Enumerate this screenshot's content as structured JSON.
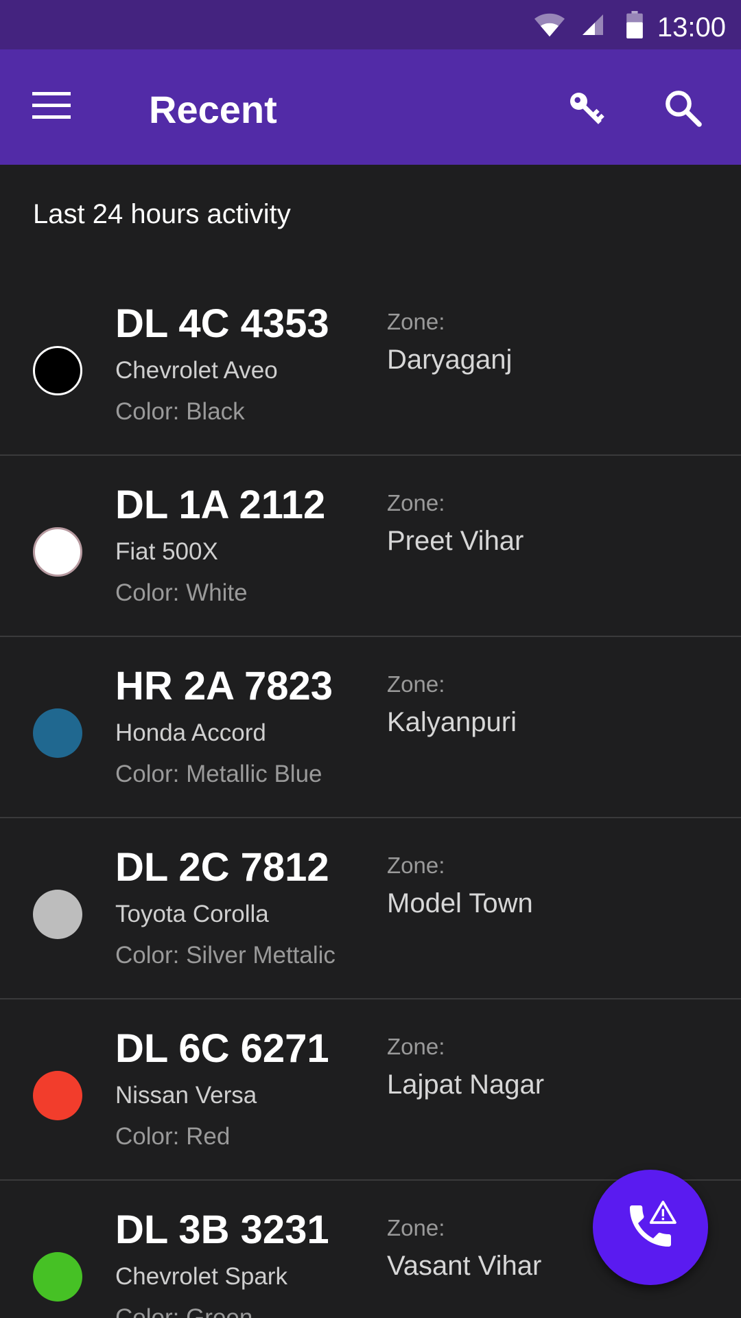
{
  "status_bar": {
    "time": "13:00",
    "icons": [
      "wifi-icon",
      "signal-icon",
      "battery-icon"
    ]
  },
  "app_bar": {
    "title": "Recent",
    "icons": [
      "menu-icon",
      "key-icon",
      "search-icon"
    ]
  },
  "subheader": "Last 24 hours activity",
  "vehicles": [
    {
      "plate": "DL 4C 4353",
      "model": "Chevrolet Aveo",
      "color_label": "Color: Black",
      "zone_label": "Zone:",
      "zone": "Daryaganj",
      "swatch": "#000000"
    },
    {
      "plate": "DL 1A 2112",
      "model": "Fiat 500X",
      "color_label": "Color: White",
      "zone_label": "Zone:",
      "zone": "Preet Vihar",
      "swatch": "#ffffff"
    },
    {
      "plate": "HR 2A 7823",
      "model": "Honda Accord",
      "color_label": "Color: Metallic Blue",
      "zone_label": "Zone:",
      "zone": "Kalyanpuri",
      "swatch": "#206890"
    },
    {
      "plate": "DL 2C 7812",
      "model": "Toyota Corolla",
      "color_label": "Color: Silver Mettalic",
      "zone_label": "Zone:",
      "zone": "Model Town",
      "swatch": "#bdbdbd"
    },
    {
      "plate": "DL 6C 6271",
      "model": "Nissan Versa",
      "color_label": "Color: Red",
      "zone_label": "Zone:",
      "zone": "Lajpat Nagar",
      "swatch": "#f23d2c"
    },
    {
      "plate": "DL 3B 3231",
      "model": "Chevrolet Spark",
      "color_label": "Color: Green",
      "zone_label": "Zone:",
      "zone": "Vasant Vihar",
      "swatch": "#46c125"
    }
  ],
  "fab": {
    "icon": "emergency-call-icon",
    "color": "#5a1bf0"
  },
  "colors": {
    "status_bar": "#44237f",
    "app_bar": "#522ba7",
    "background": "#1e1e1f"
  }
}
